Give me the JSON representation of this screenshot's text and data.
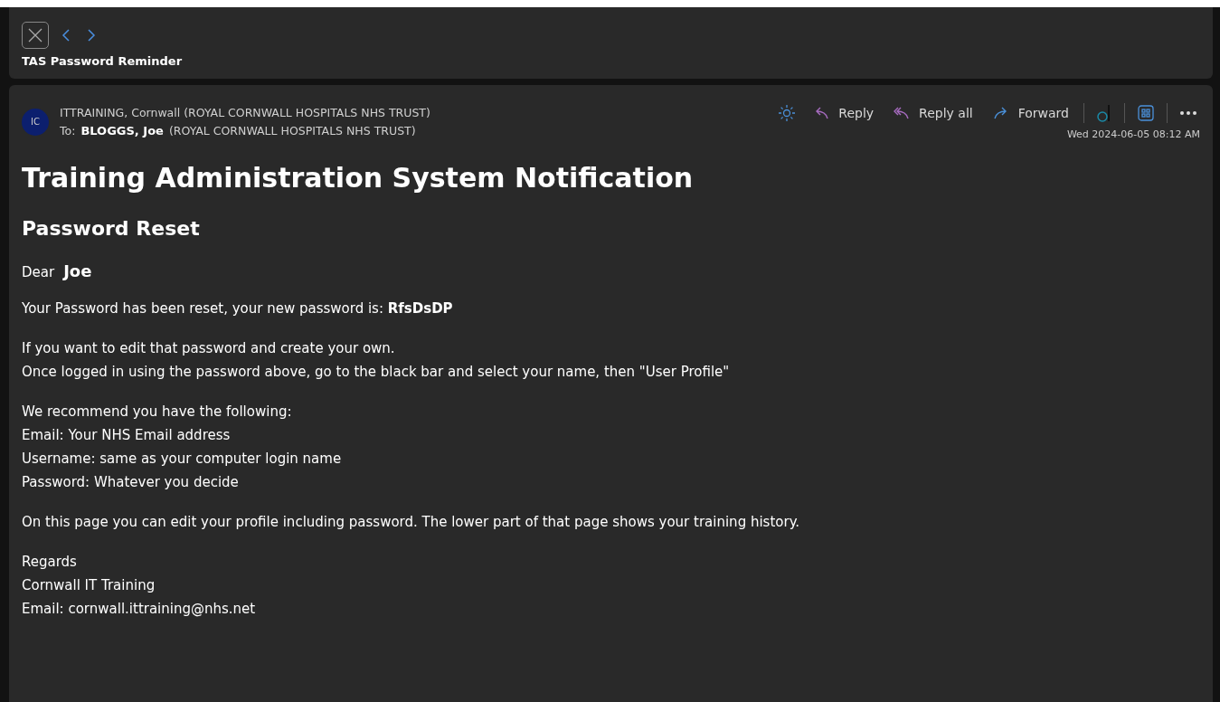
{
  "header": {
    "title": "TAS Password Reminder"
  },
  "message": {
    "avatar": "IC",
    "from": "ITTRAINING, Cornwall (ROYAL CORNWALL HOSPITALS NHS TRUST)",
    "to_label": "To:",
    "to_name": "BLOGGS, Joe",
    "to_org": "(ROYAL CORNWALL HOSPITALS NHS TRUST)",
    "actions": [
      {
        "kind": "reply",
        "label": "Reply"
      },
      {
        "kind": "replyall",
        "label": "Reply all"
      },
      {
        "kind": "forward",
        "label": "Forward"
      }
    ],
    "date": "Wed 2024-06-05 08:12 AM"
  },
  "body": {
    "heading": "Training Administration System Notification",
    "subheading": "Password Reset",
    "greeting": "Dear",
    "greeting_name": "Joe",
    "paragraphs": [
      [
        "Your Password has been reset, your new password is: **RfsDsDP**"
      ],
      [
        "If you want to edit that password and create your own.",
        "Once logged in using the password above, go to the black bar and select your name, then \"User Profile\""
      ],
      [
        "We recommend you have the following:",
        "Email: Your NHS Email address",
        "Username: same as your computer login name",
        "Password: Whatever you decide"
      ],
      [
        "On this page you can edit your profile including password. The lower part of that page shows your training history."
      ],
      [
        "Regards",
        "Cornwall IT Training",
        "Email: cornwall.ittraining@nhs.net"
      ]
    ]
  }
}
